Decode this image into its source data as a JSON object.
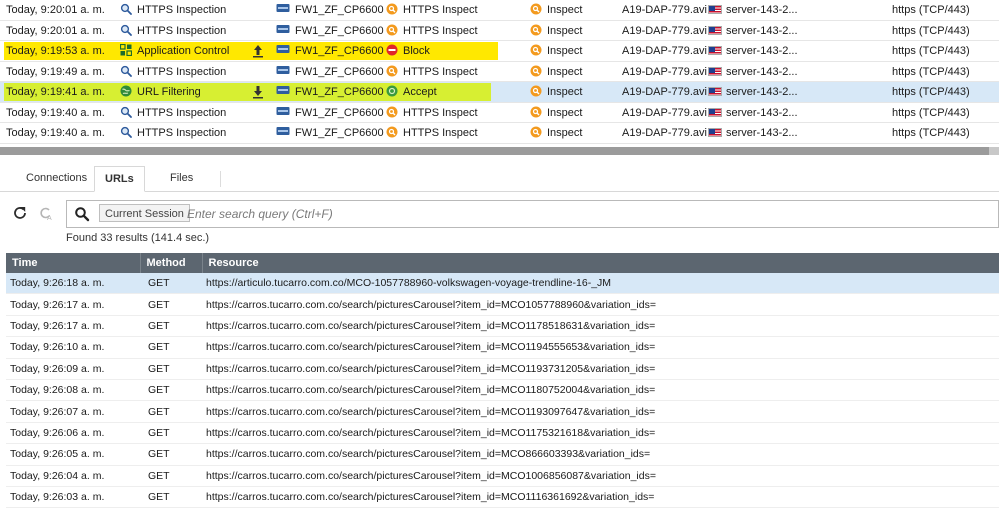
{
  "colors": {
    "highlight_yellow": "#ffe800",
    "highlight_green": "#d7ef32",
    "selected_row": "#d7e8f7",
    "header_bg": "#5c6670"
  },
  "log_rows": [
    {
      "time": "Today, 9:20:01 a. m.",
      "blade": "HTTPS Inspection",
      "blade_icon": "magnifier-icon",
      "gateway": "FW1_ZF_CP6600",
      "action": "HTTPS Inspect",
      "action_icon": "https-inspect-icon",
      "type": "Inspect",
      "source": "A19-DAP-779.avi...",
      "destination": "server-143-2...",
      "service": "https (TCP/443)",
      "highlight": "",
      "direction": "",
      "selected": false
    },
    {
      "time": "Today, 9:20:01 a. m.",
      "blade": "HTTPS Inspection",
      "blade_icon": "magnifier-icon",
      "gateway": "FW1_ZF_CP6600",
      "action": "HTTPS Inspect",
      "action_icon": "https-inspect-icon",
      "type": "Inspect",
      "source": "A19-DAP-779.avi...",
      "destination": "server-143-2...",
      "service": "https (TCP/443)",
      "highlight": "",
      "direction": "",
      "selected": false
    },
    {
      "time": "Today, 9:19:53 a. m.",
      "blade": "Application Control",
      "blade_icon": "app-control-icon",
      "gateway": "FW1_ZF_CP6600",
      "action": "Block",
      "action_icon": "block-icon",
      "type": "Inspect",
      "source": "A19-DAP-779.avi...",
      "destination": "server-143-2...",
      "service": "https (TCP/443)",
      "highlight": "yellow",
      "direction": "up",
      "selected": false
    },
    {
      "time": "Today, 9:19:49 a. m.",
      "blade": "HTTPS Inspection",
      "blade_icon": "magnifier-icon",
      "gateway": "FW1_ZF_CP6600",
      "action": "HTTPS Inspect",
      "action_icon": "https-inspect-icon",
      "type": "Inspect",
      "source": "A19-DAP-779.avi...",
      "destination": "server-143-2...",
      "service": "https (TCP/443)",
      "highlight": "",
      "direction": "",
      "selected": false
    },
    {
      "time": "Today, 9:19:41 a. m.",
      "blade": "URL Filtering",
      "blade_icon": "url-filtering-icon",
      "gateway": "FW1_ZF_CP6600",
      "action": "Accept",
      "action_icon": "accept-icon",
      "type": "Inspect",
      "source": "A19-DAP-779.avi...",
      "destination": "server-143-2...",
      "service": "https (TCP/443)",
      "highlight": "green",
      "direction": "down",
      "selected": true
    },
    {
      "time": "Today, 9:19:40 a. m.",
      "blade": "HTTPS Inspection",
      "blade_icon": "magnifier-icon",
      "gateway": "FW1_ZF_CP6600",
      "action": "HTTPS Inspect",
      "action_icon": "https-inspect-icon",
      "type": "Inspect",
      "source": "A19-DAP-779.avi...",
      "destination": "server-143-2...",
      "service": "https (TCP/443)",
      "highlight": "",
      "direction": "",
      "selected": false
    },
    {
      "time": "Today, 9:19:40 a. m.",
      "blade": "HTTPS Inspection",
      "blade_icon": "magnifier-icon",
      "gateway": "FW1_ZF_CP6600",
      "action": "HTTPS Inspect",
      "action_icon": "https-inspect-icon",
      "type": "Inspect",
      "source": "A19-DAP-779.avi...",
      "destination": "server-143-2...",
      "service": "https (TCP/443)",
      "highlight": "",
      "direction": "",
      "selected": false
    }
  ],
  "tabs": [
    {
      "label": "Connections",
      "active": false
    },
    {
      "label": "URLs",
      "active": true
    },
    {
      "label": "Files",
      "active": false
    }
  ],
  "toolbar": {
    "refresh_icon": "refresh-icon",
    "filter_icon": "filter-clear-icon"
  },
  "search": {
    "scope": "Current Session",
    "placeholder": "Enter search query (Ctrl+F)",
    "value": ""
  },
  "results_text": "Found 33 results (141.4 sec.)",
  "url_table": {
    "headers": [
      "Time",
      "Method",
      "Resource"
    ],
    "rows": [
      {
        "time": "Today, 9:26:18 a. m.",
        "method": "GET",
        "resource": "https://articulo.tucarro.com.co/MCO-1057788960-volkswagen-voyage-trendline-16-_JM",
        "selected": true
      },
      {
        "time": "Today, 9:26:17 a. m.",
        "method": "GET",
        "resource": "https://carros.tucarro.com.co/search/picturesCarousel?item_id=MCO1057788960&variation_ids=",
        "selected": false
      },
      {
        "time": "Today, 9:26:17 a. m.",
        "method": "GET",
        "resource": "https://carros.tucarro.com.co/search/picturesCarousel?item_id=MCO1178518631&variation_ids=",
        "selected": false
      },
      {
        "time": "Today, 9:26:10 a. m.",
        "method": "GET",
        "resource": "https://carros.tucarro.com.co/search/picturesCarousel?item_id=MCO1194555653&variation_ids=",
        "selected": false
      },
      {
        "time": "Today, 9:26:09 a. m.",
        "method": "GET",
        "resource": "https://carros.tucarro.com.co/search/picturesCarousel?item_id=MCO1193731205&variation_ids=",
        "selected": false
      },
      {
        "time": "Today, 9:26:08 a. m.",
        "method": "GET",
        "resource": "https://carros.tucarro.com.co/search/picturesCarousel?item_id=MCO1180752004&variation_ids=",
        "selected": false
      },
      {
        "time": "Today, 9:26:07 a. m.",
        "method": "GET",
        "resource": "https://carros.tucarro.com.co/search/picturesCarousel?item_id=MCO1193097647&variation_ids=",
        "selected": false
      },
      {
        "time": "Today, 9:26:06 a. m.",
        "method": "GET",
        "resource": "https://carros.tucarro.com.co/search/picturesCarousel?item_id=MCO1175321618&variation_ids=",
        "selected": false
      },
      {
        "time": "Today, 9:26:05 a. m.",
        "method": "GET",
        "resource": "https://carros.tucarro.com.co/search/picturesCarousel?item_id=MCO866603393&variation_ids=",
        "selected": false
      },
      {
        "time": "Today, 9:26:04 a. m.",
        "method": "GET",
        "resource": "https://carros.tucarro.com.co/search/picturesCarousel?item_id=MCO1006856087&variation_ids=",
        "selected": false
      },
      {
        "time": "Today, 9:26:03 a. m.",
        "method": "GET",
        "resource": "https://carros.tucarro.com.co/search/picturesCarousel?item_id=MCO1116361692&variation_ids=",
        "selected": false
      }
    ]
  }
}
